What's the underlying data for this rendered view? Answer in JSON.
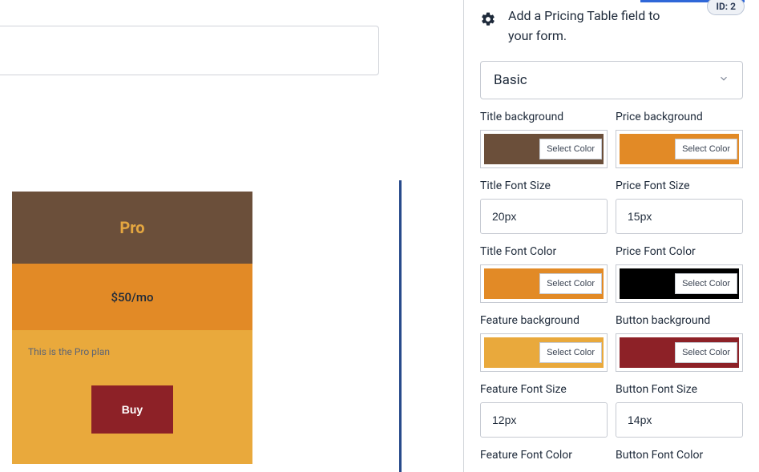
{
  "sidebar": {
    "id_badge": "ID: 2",
    "info_text": "Add a Pricing Table field to your form.",
    "dropdown_selected": "Basic",
    "select_color_label": "Select Color",
    "fields": {
      "title_bg": {
        "label": "Title background",
        "color": "#6b4f3a"
      },
      "price_bg": {
        "label": "Price background",
        "color": "#e28a26"
      },
      "title_font_size": {
        "label": "Title Font Size",
        "value": "20px"
      },
      "price_font_size": {
        "label": "Price Font Size",
        "value": "15px"
      },
      "title_font_color": {
        "label": "Title Font Color",
        "color": "#e28a26"
      },
      "price_font_color": {
        "label": "Price Font Color",
        "color": "#000000"
      },
      "feature_bg": {
        "label": "Feature background",
        "color": "#e9a93c"
      },
      "button_bg": {
        "label": "Button background",
        "color": "#8d2127"
      },
      "feature_font_size": {
        "label": "Feature Font Size",
        "value": "12px"
      },
      "button_font_size": {
        "label": "Button Font Size",
        "value": "14px"
      },
      "feature_font_color": {
        "label": "Feature Font Color"
      },
      "button_font_color": {
        "label": "Button Font Color"
      }
    }
  },
  "card": {
    "title": "Pro",
    "price": "$50/mo",
    "feature_text": "This is the Pro plan",
    "button_label": "Buy"
  },
  "colors": {
    "brown": "#6b4f3a",
    "orange": "#e28a26",
    "amber": "#e9a93c",
    "maroon": "#8d2127",
    "black": "#000000"
  }
}
